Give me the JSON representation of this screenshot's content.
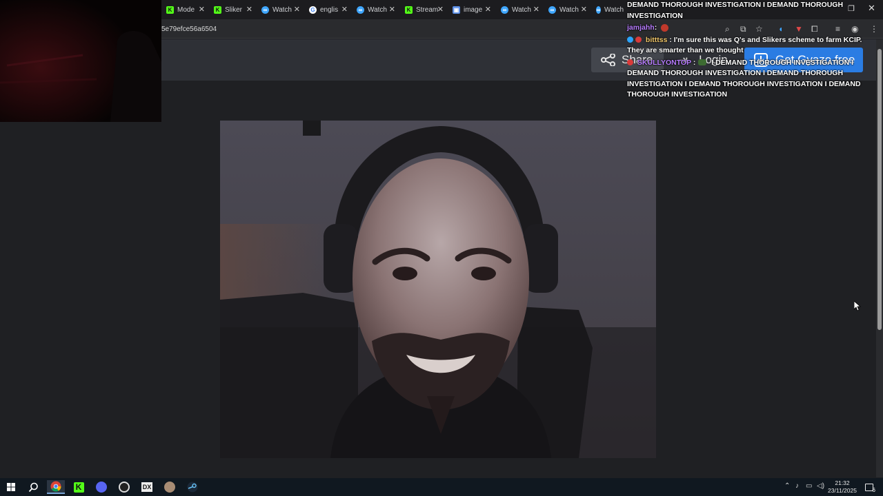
{
  "browser": {
    "tabs": [
      {
        "label": "Mode",
        "icon": "kick-icon"
      },
      {
        "label": "Sliker",
        "icon": "kick-icon"
      },
      {
        "label": "Watch",
        "icon": "watch-icon"
      },
      {
        "label": "englis",
        "icon": "google-icon"
      },
      {
        "label": "Watch",
        "icon": "watch-icon"
      },
      {
        "label": "Stream",
        "icon": "kick-icon"
      },
      {
        "label": "image",
        "icon": "image-icon"
      },
      {
        "label": "Watch",
        "icon": "watch-icon"
      },
      {
        "label": "Watch",
        "icon": "watch-icon"
      },
      {
        "label": "Watch",
        "icon": "watch-icon"
      }
    ],
    "url": "5e79efce56a6504",
    "tab_close": "✕"
  },
  "gyazo": {
    "share_label": "Share",
    "login_label": "Login",
    "get_label": "Get Gyazo free",
    "accent_color": "#2a7ce3"
  },
  "chat": {
    "messages": [
      {
        "user": "",
        "text": "DEMAND THOROUGH INVESTIGATION  I DEMAND THOROUGH INVESTIGATION"
      },
      {
        "user": "jamjahh",
        "text": ""
      },
      {
        "user": "bitttss",
        "text": "I'm sure this was Q's and Slikers scheme to farm KCIP. They are smarter than we thought"
      },
      {
        "user": "SKULLYONTOP",
        "text": "I DEMAND THOROUGH INVESTIGATION  I DEMAND THOROUGH INVESTIGATION  I DEMAND THOROUGH INVESTIGATION  I DEMAND THOROUGH INVESTIGATION  I DEMAND THOROUGH INVESTIGATION"
      }
    ],
    "separator": ":"
  },
  "taskbar": {
    "time": "21:32",
    "date": "23/11/2025",
    "notification_count": "6"
  }
}
